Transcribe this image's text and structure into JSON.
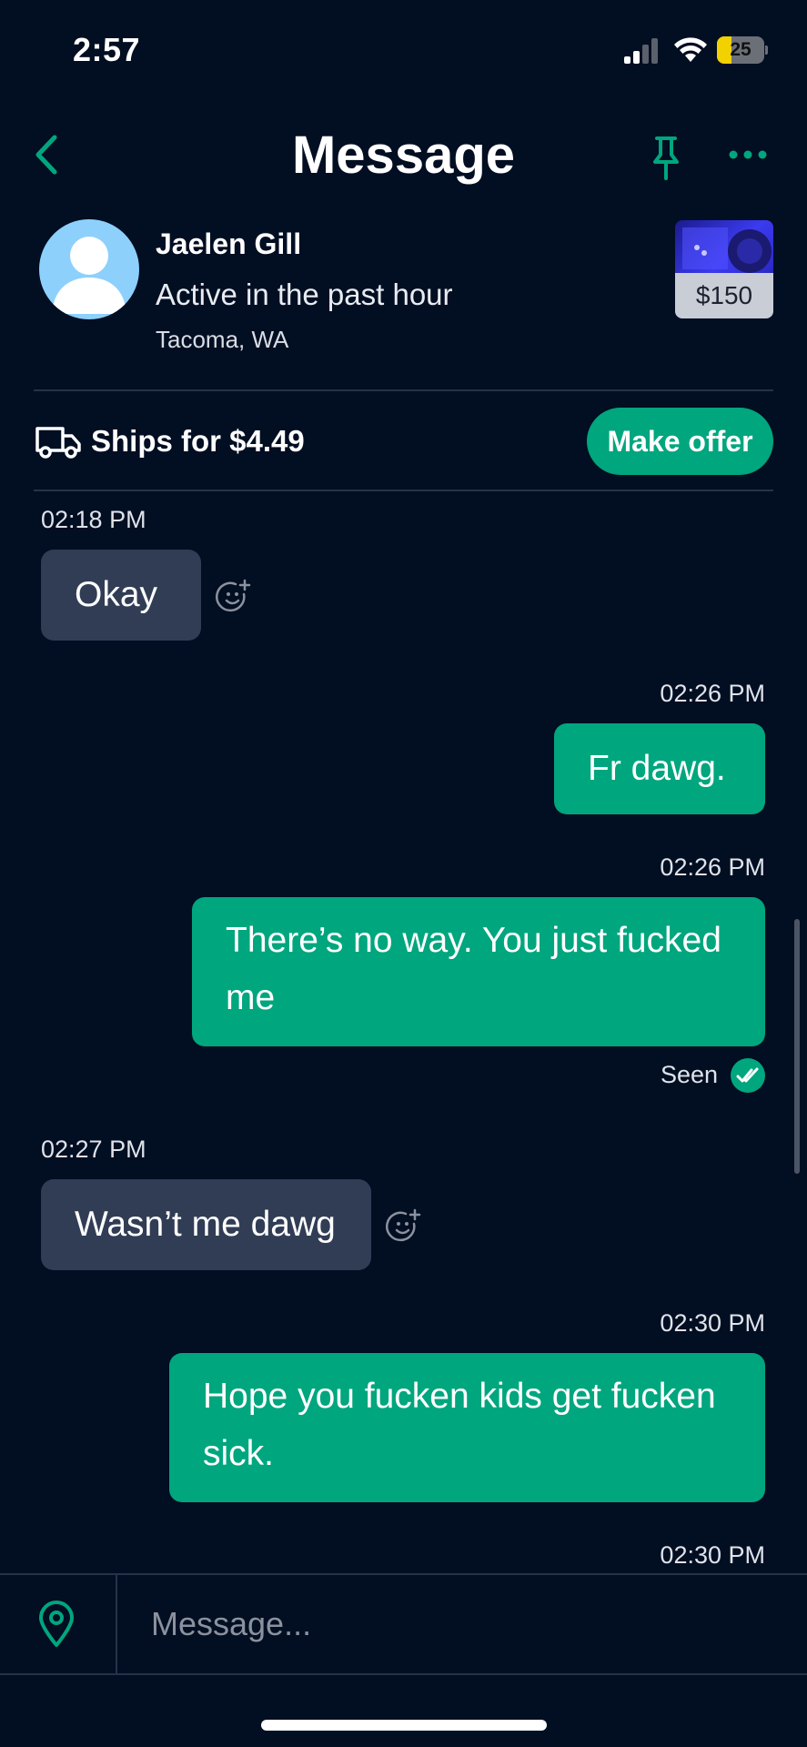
{
  "status_bar": {
    "time": "2:57",
    "battery": "25"
  },
  "header": {
    "title": "Message",
    "icons": [
      "back-chevron-icon",
      "pin-icon",
      "more-icon"
    ]
  },
  "seller": {
    "name": "Jaelen Gill",
    "status": "Active in the past hour",
    "location": "Tacoma, WA"
  },
  "listing": {
    "price": "$150"
  },
  "shipping": {
    "text": "Ships for $4.49",
    "offer_label": "Make offer"
  },
  "messages": [
    {
      "direction": "in",
      "time": "02:18 PM",
      "lines": [
        "Okay"
      ]
    },
    {
      "direction": "out",
      "time": "02:26 PM",
      "lines": [
        "Fr dawg."
      ]
    },
    {
      "direction": "out",
      "time": "02:26 PM",
      "lines": [
        "There’s no way. You just fucked",
        "me"
      ]
    },
    {
      "direction": "in",
      "time": "02:27 PM",
      "lines": [
        "Wasn’t me dawg"
      ]
    },
    {
      "direction": "out",
      "time": "02:30 PM",
      "lines": [
        "Hope you fucken kids get fucken",
        "sick."
      ]
    },
    {
      "direction": "out",
      "time": "02:30 PM",
      "lines": []
    }
  ],
  "read_receipt": {
    "label": "Seen"
  },
  "composer": {
    "placeholder": "Message..."
  },
  "colors": {
    "background": "#020e22",
    "accent": "#00a67e",
    "incoming_bubble": "#313d55",
    "divider": "#253247"
  }
}
